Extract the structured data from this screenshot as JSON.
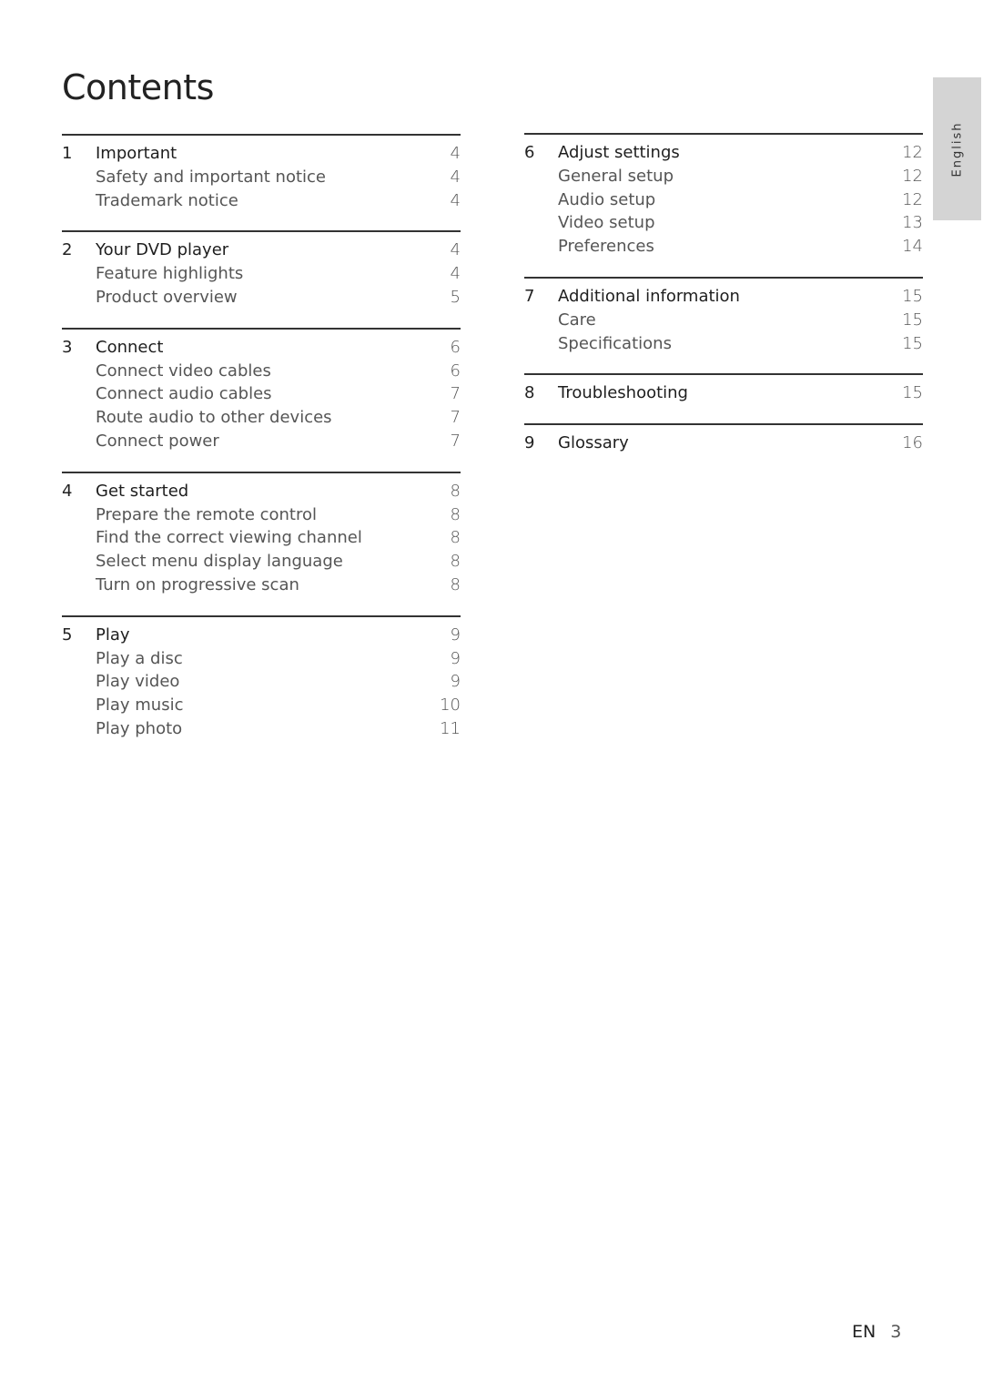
{
  "title": "Contents",
  "language_tab": "English",
  "footer": {
    "lang": "EN",
    "page": "3"
  },
  "sections": [
    {
      "num": "1",
      "label": "Important",
      "page": "4",
      "items": [
        {
          "label": "Safety and important notice",
          "page": "4"
        },
        {
          "label": "Trademark notice",
          "page": "4"
        }
      ]
    },
    {
      "num": "2",
      "label": "Your DVD player",
      "page": "4",
      "items": [
        {
          "label": "Feature highlights",
          "page": "4"
        },
        {
          "label": "Product overview",
          "page": "5"
        }
      ]
    },
    {
      "num": "3",
      "label": "Connect",
      "page": "6",
      "items": [
        {
          "label": "Connect video cables",
          "page": "6"
        },
        {
          "label": "Connect audio cables",
          "page": "7"
        },
        {
          "label": "Route audio to other devices",
          "page": "7"
        },
        {
          "label": "Connect power",
          "page": "7"
        }
      ]
    },
    {
      "num": "4",
      "label": "Get started",
      "page": "8",
      "items": [
        {
          "label": "Prepare the remote control",
          "page": "8"
        },
        {
          "label": "Find the correct viewing channel",
          "page": "8"
        },
        {
          "label": "Select menu display language",
          "page": "8"
        },
        {
          "label": "Turn on progressive scan",
          "page": "8"
        }
      ]
    },
    {
      "num": "5",
      "label": "Play",
      "page": "9",
      "items": [
        {
          "label": "Play a disc",
          "page": "9"
        },
        {
          "label": "Play video",
          "page": "9"
        },
        {
          "label": "Play music",
          "page": "10"
        },
        {
          "label": "Play photo",
          "page": "11"
        }
      ]
    },
    {
      "num": "6",
      "label": "Adjust settings",
      "page": "12",
      "items": [
        {
          "label": "General setup",
          "page": "12"
        },
        {
          "label": "Audio setup",
          "page": "12"
        },
        {
          "label": "Video setup",
          "page": "13"
        },
        {
          "label": "Preferences",
          "page": "14"
        }
      ]
    },
    {
      "num": "7",
      "label": "Additional information",
      "page": "15",
      "items": [
        {
          "label": "Care",
          "page": "15"
        },
        {
          "label": "Specifications",
          "page": "15"
        }
      ]
    },
    {
      "num": "8",
      "label": "Troubleshooting",
      "page": "15",
      "items": []
    },
    {
      "num": "9",
      "label": "Glossary",
      "page": "16",
      "items": []
    }
  ]
}
